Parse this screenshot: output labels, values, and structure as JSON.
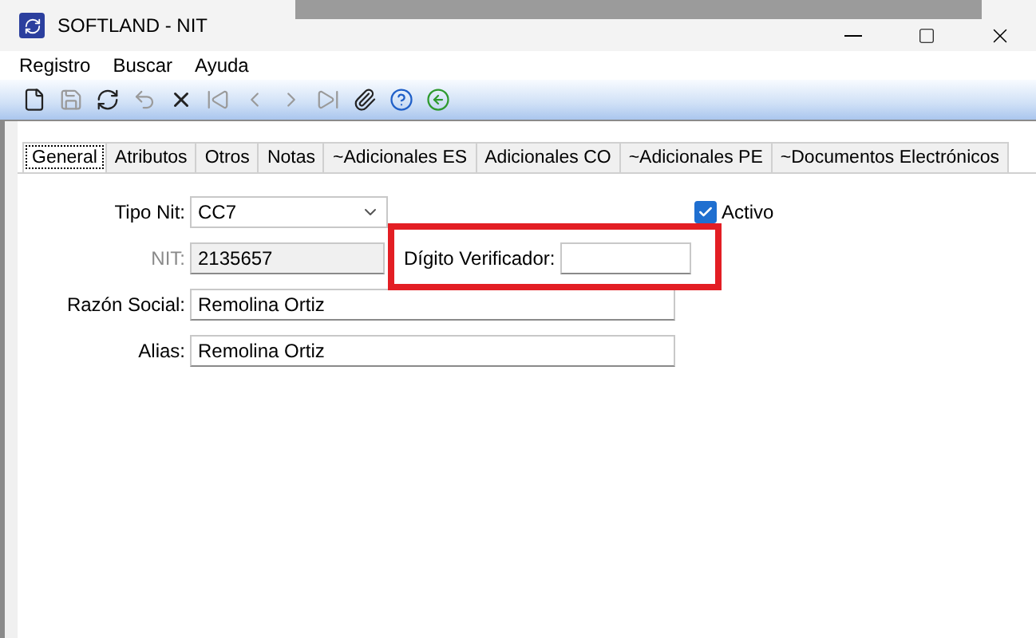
{
  "window": {
    "title": "SOFTLAND - NIT"
  },
  "menu": [
    "Registro",
    "Buscar",
    "Ayuda"
  ],
  "toolbar": [
    {
      "kind": "new",
      "disabled": false
    },
    {
      "kind": "save",
      "disabled": true
    },
    {
      "kind": "saveas",
      "disabled": false
    },
    {
      "kind": "undo",
      "disabled": true
    },
    {
      "kind": "delete",
      "disabled": false
    },
    {
      "kind": "first",
      "disabled": true
    },
    {
      "kind": "prev",
      "disabled": true
    },
    {
      "kind": "next",
      "disabled": true
    },
    {
      "kind": "last",
      "disabled": true
    },
    {
      "kind": "attach",
      "disabled": false
    },
    {
      "kind": "help",
      "disabled": false
    },
    {
      "kind": "back",
      "disabled": false
    }
  ],
  "tabs": [
    {
      "label": "General",
      "selected": true
    },
    {
      "label": "Atributos",
      "selected": false
    },
    {
      "label": "Otros",
      "selected": false
    },
    {
      "label": "Notas",
      "selected": false
    },
    {
      "label": "~Adicionales ES",
      "selected": false
    },
    {
      "label": "Adicionales CO",
      "selected": false
    },
    {
      "label": "~Adicionales PE",
      "selected": false
    },
    {
      "label": "~Documentos Electrónicos",
      "selected": false
    }
  ],
  "form": {
    "tipo_nit": {
      "label": "Tipo Nit:",
      "value": "CC7"
    },
    "activo": {
      "label": "Activo",
      "checked": true
    },
    "nit": {
      "label": "NIT:",
      "value": "2135657",
      "disabled": true
    },
    "digito": {
      "label": "Dígito Verificador:",
      "highlighted": true
    },
    "razon_social": {
      "label": "Razón Social:",
      "value": "Remolina Ortiz"
    },
    "alias": {
      "label": "Alias:",
      "value": "Remolina Ortiz"
    }
  }
}
